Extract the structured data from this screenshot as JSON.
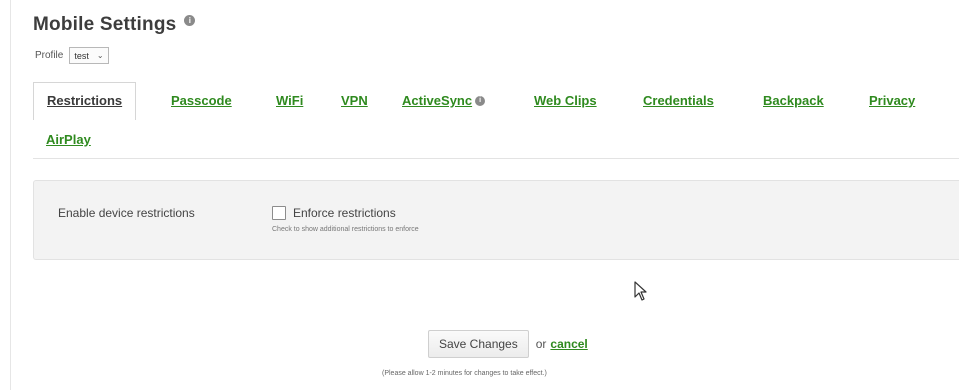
{
  "page": {
    "title": "Mobile Settings",
    "title_info_icon": "info-icon",
    "profile_label": "Profile",
    "profile_value": "test"
  },
  "tabs": [
    {
      "label": "Restrictions",
      "active": true
    },
    {
      "label": "Passcode",
      "active": false
    },
    {
      "label": "WiFi",
      "active": false
    },
    {
      "label": "VPN",
      "active": false
    },
    {
      "label": "ActiveSync",
      "active": false,
      "info_icon": "info-icon"
    },
    {
      "label": "Web Clips",
      "active": false
    },
    {
      "label": "Credentials",
      "active": false
    },
    {
      "label": "Backpack",
      "active": false
    },
    {
      "label": "Privacy",
      "active": false
    },
    {
      "label": "AirPlay",
      "active": false
    }
  ],
  "restrictions": {
    "setting_label": "Enable device restrictions",
    "checkbox_label": "Enforce restrictions",
    "checkbox_checked": false,
    "help_text": "Check to show additional restrictions to enforce"
  },
  "footer": {
    "save_label": "Save Changes",
    "or_text": "or",
    "cancel_label": "cancel",
    "note": "(Please allow 1-2 minutes for changes to take effect.)"
  },
  "colors": {
    "link_green": "#2f8a1f",
    "panel_bg": "#f3f3f3"
  },
  "cursor_icon": "mouse-pointer-icon"
}
